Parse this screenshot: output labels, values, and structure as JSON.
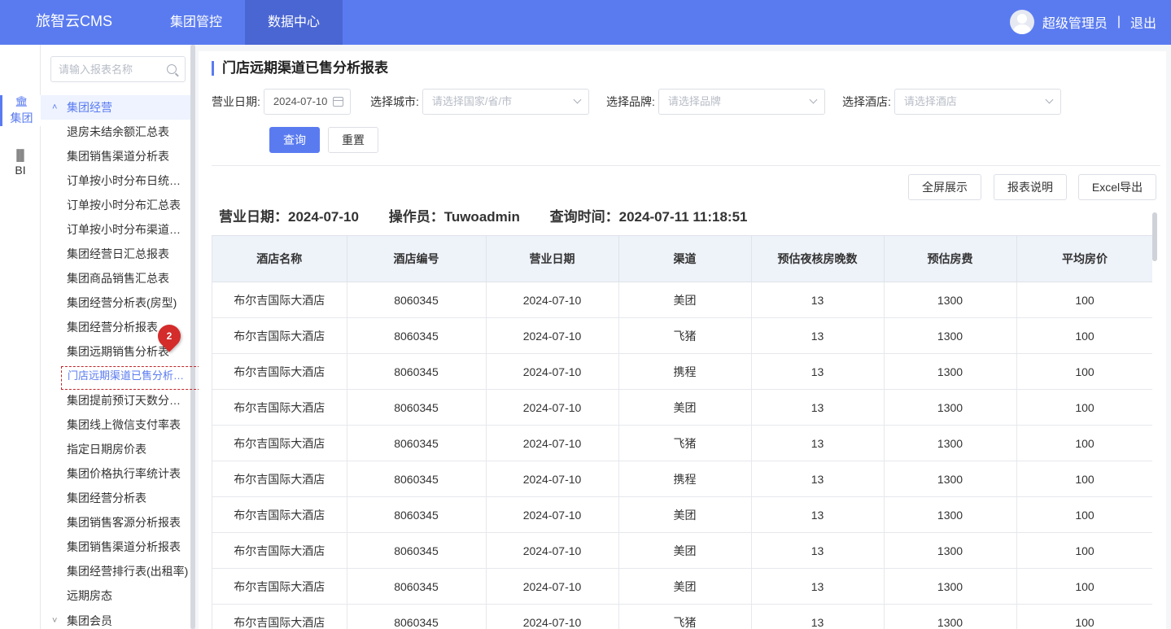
{
  "header": {
    "brand": "旅智云CMS",
    "nav": [
      {
        "label": "集团管控",
        "active": false
      },
      {
        "label": "数据中心",
        "active": true
      }
    ],
    "user": "超级管理员",
    "separator": "|",
    "logout": "退出"
  },
  "rail": {
    "items": [
      {
        "label": "集团",
        "icon": "building-icon",
        "active": true
      },
      {
        "label": "BI",
        "icon": "bar-chart-icon",
        "active": false
      }
    ]
  },
  "sidebar": {
    "search_placeholder": "请输入报表名称",
    "group_open": "集团经营",
    "items": [
      "退房未结余额汇总表",
      "集团销售渠道分析表",
      "订单按小时分布日统计表",
      "订单按小时分布汇总表",
      "订单按小时分布渠道统计表",
      "集团经营日汇总报表",
      "集团商品销售汇总表",
      "集团经营分析表(房型)",
      "集团经营分析报表",
      "集团远期销售分析表",
      "门店远期渠道已售分析报表",
      "集团提前预订天数分析表",
      "集团线上微信支付率表",
      "指定日期房价表",
      "集团价格执行率统计表",
      "集团经营分析表",
      "集团销售客源分析报表",
      "集团销售渠道分析报表",
      "集团经营排行表(出租率)",
      "远期房态"
    ],
    "active_index": 10,
    "group_closed": "集团会员",
    "marker": "2"
  },
  "main": {
    "title": "门店远期渠道已售分析报表",
    "filters": {
      "date_label": "营业日期:",
      "date_value": "2024-07-10",
      "city_label": "选择城市:",
      "city_placeholder": "请选择国家/省/市",
      "brand_label": "选择品牌:",
      "brand_placeholder": "请选择品牌",
      "hotel_label": "选择酒店:",
      "hotel_placeholder": "请选择酒店"
    },
    "query_button": "查询",
    "reset_button": "重置",
    "fullscreen_button": "全屏展示",
    "explain_button": "报表说明",
    "export_button": "Excel导出",
    "info": {
      "date": "营业日期：2024-07-10",
      "operator": "操作员：Tuwoadmin",
      "query_time": "查询时间：2024-07-11 11:18:51"
    },
    "table": {
      "columns": [
        "酒店名称",
        "酒店编号",
        "营业日期",
        "渠道",
        "预估夜核房晚数",
        "预估房费",
        "平均房价"
      ],
      "rows": [
        [
          "布尔吉国际大酒店",
          "8060345",
          "2024-07-10",
          "美团",
          "13",
          "1300",
          "100"
        ],
        [
          "布尔吉国际大酒店",
          "8060345",
          "2024-07-10",
          "飞猪",
          "13",
          "1300",
          "100"
        ],
        [
          "布尔吉国际大酒店",
          "8060345",
          "2024-07-10",
          "携程",
          "13",
          "1300",
          "100"
        ],
        [
          "布尔吉国际大酒店",
          "8060345",
          "2024-07-10",
          "美团",
          "13",
          "1300",
          "100"
        ],
        [
          "布尔吉国际大酒店",
          "8060345",
          "2024-07-10",
          "飞猪",
          "13",
          "1300",
          "100"
        ],
        [
          "布尔吉国际大酒店",
          "8060345",
          "2024-07-10",
          "携程",
          "13",
          "1300",
          "100"
        ],
        [
          "布尔吉国际大酒店",
          "8060345",
          "2024-07-10",
          "美团",
          "13",
          "1300",
          "100"
        ],
        [
          "布尔吉国际大酒店",
          "8060345",
          "2024-07-10",
          "美团",
          "13",
          "1300",
          "100"
        ],
        [
          "布尔吉国际大酒店",
          "8060345",
          "2024-07-10",
          "美团",
          "13",
          "1300",
          "100"
        ],
        [
          "布尔吉国际大酒店",
          "8060345",
          "2024-07-10",
          "飞猪",
          "13",
          "1300",
          "100"
        ]
      ]
    }
  },
  "colors": {
    "primary": "#5a7bf0",
    "nav_active": "#4a66d3",
    "highlight": "#c0262a",
    "marker": "#d42b2b"
  }
}
